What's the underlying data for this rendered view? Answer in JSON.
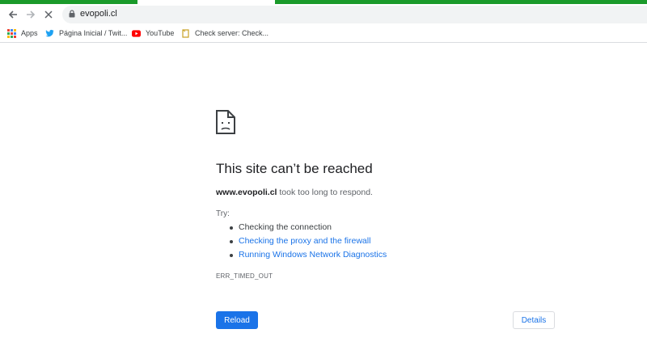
{
  "browser": {
    "url": "evopoli.cl",
    "bookmarks": [
      {
        "label": "Apps",
        "icon": "apps-grid-icon"
      },
      {
        "label": "Página Inicial / Twit...",
        "icon": "twitter-icon"
      },
      {
        "label": "YouTube",
        "icon": "youtube-icon"
      },
      {
        "label": "Check server: Check...",
        "icon": "bookmark-page-icon"
      }
    ]
  },
  "error_page": {
    "title": "This site can’t be reached",
    "host": "www.evopoli.cl",
    "message_suffix": " took too long to respond.",
    "try_label": "Try:",
    "suggestions": [
      "Checking the connection",
      "Checking the proxy and the firewall",
      "Running Windows Network Diagnostics"
    ],
    "error_code": "ERR_TIMED_OUT",
    "reload_label": "Reload",
    "details_label": "Details"
  },
  "colors": {
    "accent": "#1a73e8",
    "loading_bar": "#1a9a2a",
    "text_primary": "#202124",
    "text_secondary": "#5f6368"
  }
}
